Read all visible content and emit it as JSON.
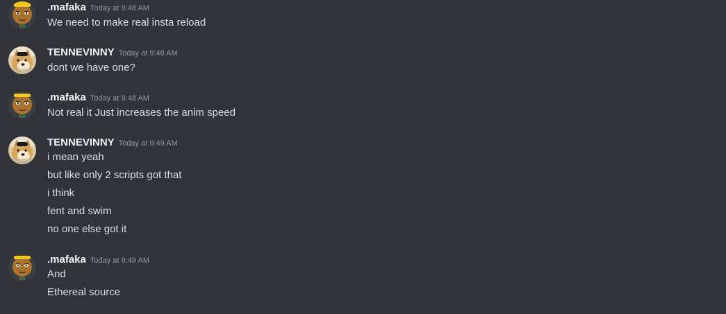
{
  "messages": [
    {
      "author": ".mafaka",
      "avatar": "roblox-avatar-icon",
      "time": "Today at 9:48 AM",
      "lines": [
        "We need to make real insta reload"
      ]
    },
    {
      "author": "TENNEVINNY",
      "avatar": "doge-avatar-icon",
      "time": "Today at 9:48 AM",
      "lines": [
        "dont we have one?"
      ]
    },
    {
      "author": ".mafaka",
      "avatar": "roblox-avatar-icon",
      "time": "Today at 9:48 AM",
      "lines": [
        "Not real it Just increases the anim speed"
      ]
    },
    {
      "author": "TENNEVINNY",
      "avatar": "doge-avatar-icon",
      "time": "Today at 9:49 AM",
      "lines": [
        "i mean yeah",
        "but like only 2 scripts got that",
        "i think",
        "fent and swim",
        "no one else got it"
      ]
    },
    {
      "author": ".mafaka",
      "avatar": "roblox-avatar-icon",
      "time": "Today at 9:49 AM",
      "lines": [
        "And",
        "Ethereal source"
      ]
    }
  ],
  "colors": {
    "background": "#313338",
    "username": "#f2f3f5",
    "timestamp": "#949ba4",
    "message_text": "#dbdee1"
  }
}
